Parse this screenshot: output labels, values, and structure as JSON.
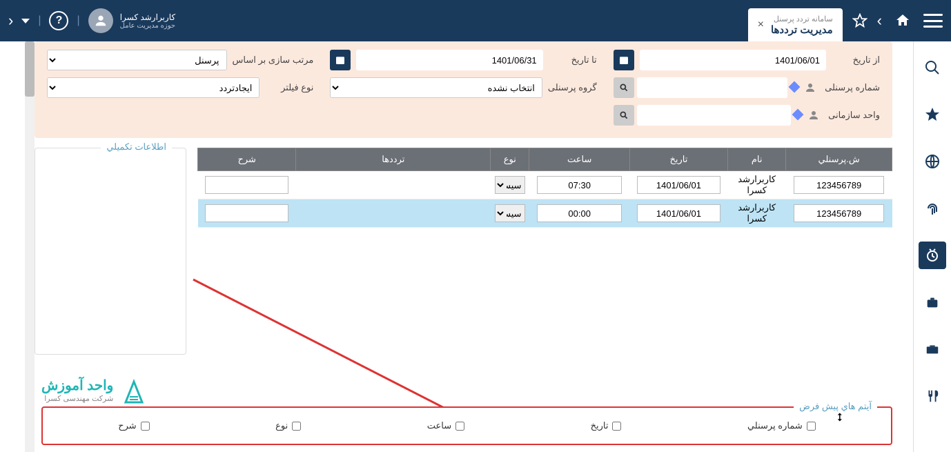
{
  "topbar": {
    "tab_sub": "سامانه تردد پرسنل",
    "tab_title": "مدیریت ترددها",
    "close": "×"
  },
  "user": {
    "name": "کاربرارشد کسرا",
    "role": "حوزه مدیریت عامل",
    "help": "?"
  },
  "filter": {
    "from_lbl": "از تاریخ",
    "from_val": "1401/06/01",
    "to_lbl": "تا تاریخ",
    "to_val": "1401/06/31",
    "sort_lbl": "مرتب سازی بر اساس",
    "sort_val": "پرسنل",
    "pid_lbl": "شماره پرسنلی",
    "group_lbl": "گروه پرسنلی",
    "group_val": "انتخاب نشده",
    "ftype_lbl": "نوع فیلتر",
    "ftype_val": "ایجادتردد",
    "org_lbl": "واحد سازمانی"
  },
  "thead": {
    "c1": "ش.پرسنلي",
    "c2": "نام",
    "c3": "تاريخ",
    "c4": "ساعت",
    "c5": "نوع",
    "c6": "ترددها",
    "c7": "شرح"
  },
  "rows": [
    {
      "pid": "123456789",
      "name": "کاربرارشد کسرا",
      "date": "1401/06/01",
      "time": "07:30",
      "type": "سيستم"
    },
    {
      "pid": "123456789",
      "name": "کاربرارشد کسرا",
      "date": "1401/06/01",
      "time": "00:00",
      "type": "سيستم"
    }
  ],
  "side": {
    "title": "اطلاعات تکميلي"
  },
  "defaults": {
    "title": "آيتم هاي پيش فرض",
    "items": {
      "pid": "شماره پرسنلي",
      "date": "تاريخ",
      "time": "ساعت",
      "type": "نوع",
      "desc": "شرح"
    }
  },
  "logo": {
    "t1": "واحد آموزش",
    "t2": "شرکت مهندسی کسرا"
  }
}
